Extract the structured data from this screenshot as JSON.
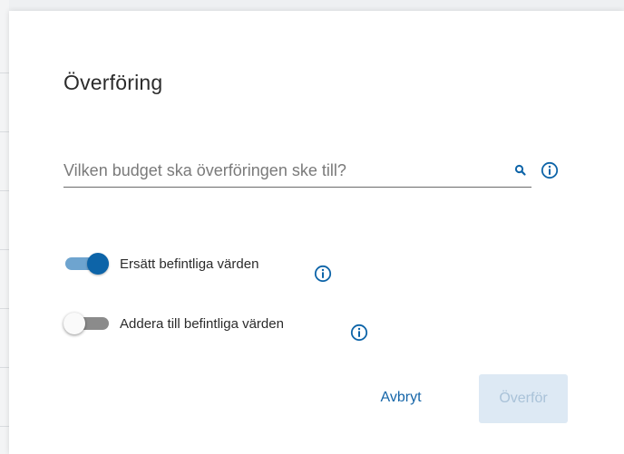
{
  "dialog": {
    "title": "Överföring",
    "search": {
      "placeholder": "Vilken budget ska överföringen ske till?",
      "value": ""
    },
    "options": [
      {
        "label": "Ersätt befintliga värden",
        "checked": true
      },
      {
        "label": "Addera till befintliga värden",
        "checked": false
      }
    ],
    "buttons": {
      "cancel": "Avbryt",
      "transfer": "Överför"
    }
  },
  "colors": {
    "accent": "#0d64a8",
    "link": "#1565a8",
    "disabled_button_bg": "#dde9f4",
    "disabled_button_text": "#a9c2d8"
  },
  "icons": [
    "search-icon",
    "info-icon"
  ]
}
